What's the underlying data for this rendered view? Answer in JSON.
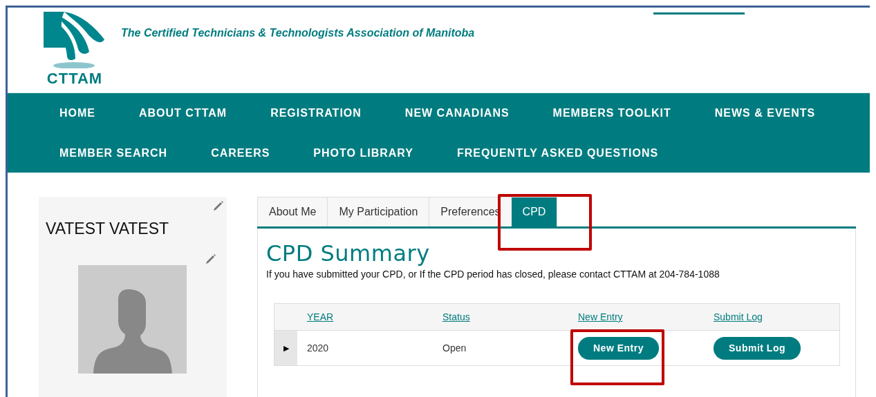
{
  "header": {
    "logo_text": "CTTAM",
    "tagline": "The Certified Technicians & Technologists Association of Manitoba"
  },
  "nav": {
    "items": [
      "HOME",
      "ABOUT CTTAM",
      "REGISTRATION",
      "NEW CANADIANS",
      "MEMBERS TOOLKIT",
      "NEWS & EVENTS",
      "MEMBER SEARCH",
      "CAREERS",
      "PHOTO LIBRARY",
      "FREQUENTLY ASKED QUESTIONS"
    ]
  },
  "profile": {
    "name": "VATEST VATEST"
  },
  "tabs": [
    {
      "label": "About Me",
      "selected": false
    },
    {
      "label": "My Participation",
      "selected": false
    },
    {
      "label": "Preferences",
      "selected": false
    },
    {
      "label": "CPD",
      "selected": true
    }
  ],
  "cpd": {
    "title": "CPD Summary",
    "note": "If you have submitted your CPD, or If the CPD period has closed, please contact CTTAM at 204-784-1088",
    "table": {
      "columns": [
        "YEAR",
        "Status",
        "New Entry",
        "Submit Log"
      ],
      "rows": [
        {
          "expander": "▶",
          "year": "2020",
          "status": "Open",
          "new_entry": "New Entry",
          "submit_log": "Submit Log"
        }
      ]
    }
  }
}
